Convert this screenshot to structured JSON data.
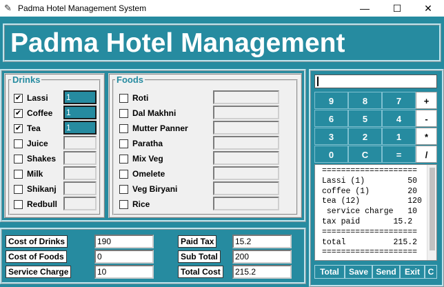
{
  "window": {
    "title": "Padma Hotel Management System",
    "minimize": "—",
    "maximize": "☐",
    "close": "✕"
  },
  "header": {
    "title": "Padma Hotel Management"
  },
  "drinks": {
    "legend": "Drinks",
    "items": [
      {
        "label": "Lassi",
        "checked": true,
        "qty": "1"
      },
      {
        "label": "Coffee",
        "checked": true,
        "qty": "1"
      },
      {
        "label": "Tea",
        "checked": true,
        "qty": "1"
      },
      {
        "label": "Juice",
        "checked": false,
        "qty": ""
      },
      {
        "label": "Shakes",
        "checked": false,
        "qty": ""
      },
      {
        "label": "Milk",
        "checked": false,
        "qty": ""
      },
      {
        "label": "Shikanj",
        "checked": false,
        "qty": ""
      },
      {
        "label": "Redbull",
        "checked": false,
        "qty": ""
      }
    ]
  },
  "foods": {
    "legend": "Foods",
    "items": [
      {
        "label": "Roti",
        "checked": false,
        "qty": ""
      },
      {
        "label": "Dal Makhni",
        "checked": false,
        "qty": ""
      },
      {
        "label": "Mutter Panner",
        "checked": false,
        "qty": ""
      },
      {
        "label": "Paratha",
        "checked": false,
        "qty": ""
      },
      {
        "label": "Mix Veg",
        "checked": false,
        "qty": ""
      },
      {
        "label": "Omelete",
        "checked": false,
        "qty": ""
      },
      {
        "label": "Veg Biryani",
        "checked": false,
        "qty": ""
      },
      {
        "label": "Rice",
        "checked": false,
        "qty": ""
      }
    ]
  },
  "costs": {
    "cost_of_drinks_label": "Cost of Drinks",
    "cost_of_drinks": "190",
    "cost_of_foods_label": "Cost of Foods",
    "cost_of_foods": "0",
    "service_charge_label": "Service Charge",
    "service_charge": "10",
    "paid_tax_label": "Paid Tax",
    "paid_tax": "15.2",
    "sub_total_label": "Sub Total",
    "sub_total": "200",
    "total_cost_label": "Total Cost",
    "total_cost": "215.2"
  },
  "calculator": {
    "display": "",
    "keys": [
      [
        "9",
        "8",
        "7",
        "+"
      ],
      [
        "6",
        "5",
        "4",
        "-"
      ],
      [
        "3",
        "2",
        "1",
        "*"
      ],
      [
        "0",
        "C",
        "=",
        "/"
      ]
    ]
  },
  "receipt": {
    "text": "====================\nLassi (1)         50\ncoffee (1)        20\ntea (12)          120\n service charge   10\ntax paid       15.2\n====================\ntotal          215.2\n===================="
  },
  "actions": {
    "total": "Total",
    "save": "Save",
    "send": "Send",
    "exit": "Exit",
    "clear": "C"
  },
  "colors": {
    "accent": "#268ba0"
  }
}
